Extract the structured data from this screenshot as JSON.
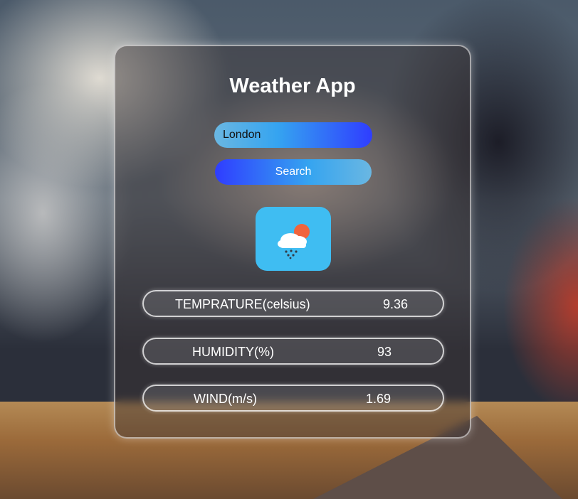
{
  "app": {
    "title": "Weather App"
  },
  "search": {
    "value": "London",
    "button_label": "Search"
  },
  "weather_icon": {
    "name": "cloud-rain-sun-icon"
  },
  "stats": {
    "temperature": {
      "label": "TEMPRATURE(celsius)",
      "value": "9.36"
    },
    "humidity": {
      "label": "HUMIDITY(%)",
      "value": "93"
    },
    "wind": {
      "label": "WIND(m/s)",
      "value": "1.69"
    }
  },
  "colors": {
    "accent_blue": "#2f3dff",
    "accent_cyan": "#6ab7e2",
    "icon_tile": "#3fbdf2"
  }
}
